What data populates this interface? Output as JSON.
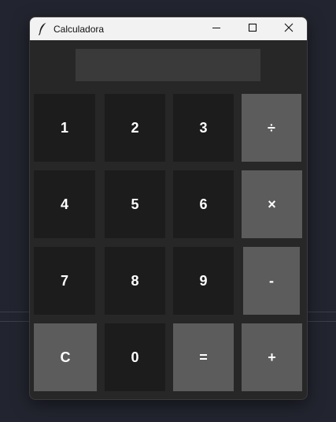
{
  "window": {
    "title": "Calculadora",
    "app_icon": "feather-icon",
    "controls": [
      "minimize-icon",
      "maximize-icon",
      "close-icon"
    ]
  },
  "display": {
    "value": ""
  },
  "keypad": {
    "k1": "1",
    "k2": "2",
    "k3": "3",
    "divide": "÷",
    "k4": "4",
    "k5": "5",
    "k6": "6",
    "multiply": "×",
    "k7": "7",
    "k8": "8",
    "k9": "9",
    "subtract": "-",
    "clear": "C",
    "k0": "0",
    "equals": "=",
    "add": "+"
  },
  "colors": {
    "window_bg": "#272727",
    "number_key": "#1c1c1c",
    "operator_key": "#5c5c5c",
    "display_bg": "#3a3a3a",
    "key_text": "#ffffff"
  }
}
